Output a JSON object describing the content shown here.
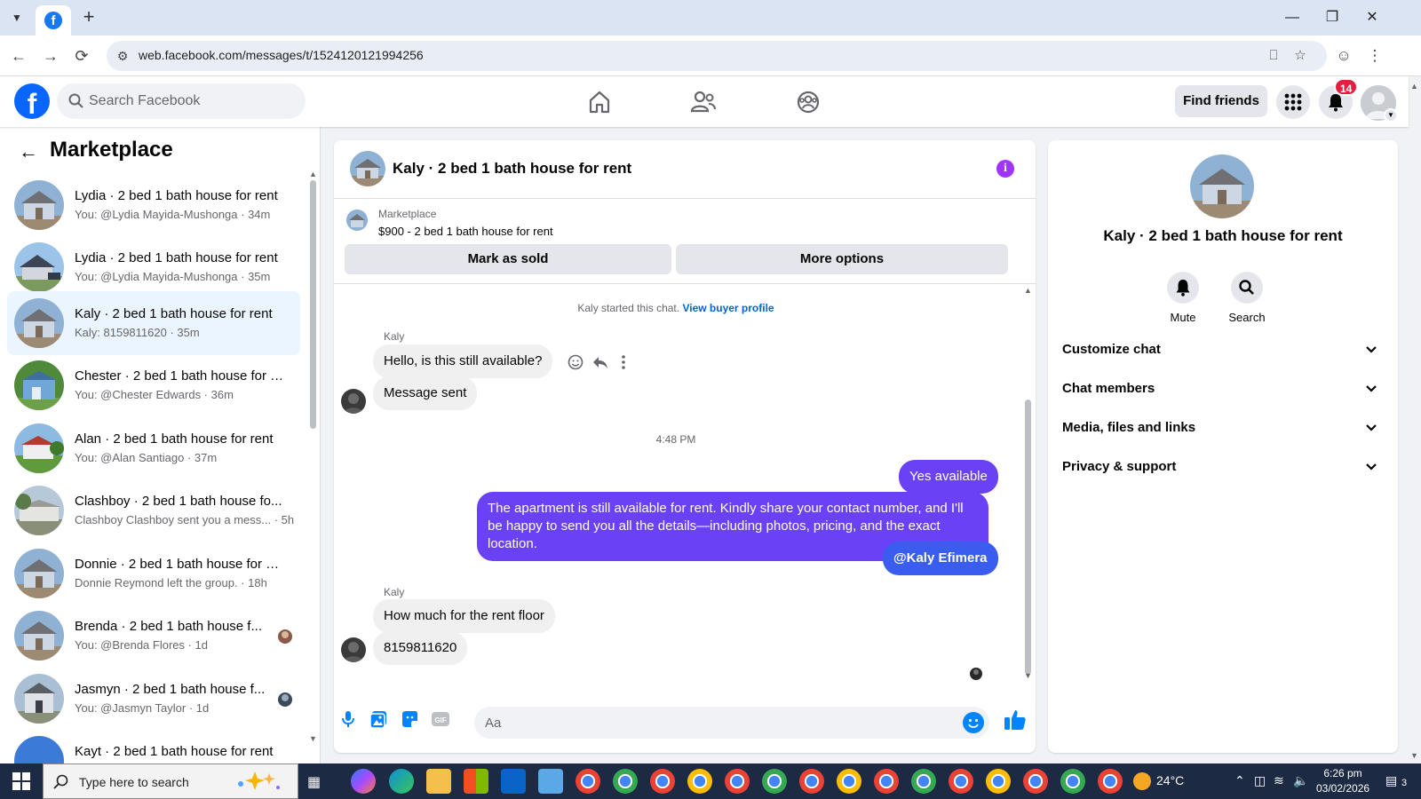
{
  "browser": {
    "url": "web.facebook.com/messages/t/1524120121994256",
    "tab_icon": "facebook-icon"
  },
  "header": {
    "search_placeholder": "Search Facebook",
    "find_friends": "Find friends",
    "notification_count": "14"
  },
  "sidebar": {
    "title": "Marketplace",
    "conversations": [
      {
        "title": "Lydia · 2 bed 1 bath house for rent",
        "sub": "You: @Lydia Mayida-Mushonga · 34m"
      },
      {
        "title": "Lydia · 2 bed 1 bath house for rent",
        "sub": "You: @Lydia Mayida-Mushonga · 35m"
      },
      {
        "title": "Kaly · 2 bed 1 bath house for rent",
        "sub": "Kaly: 8159811620 · 35m"
      },
      {
        "title": "Chester · 2 bed 1 bath house for …",
        "sub": "You: @Chester Edwards · 36m"
      },
      {
        "title": "Alan · 2 bed 1 bath house for rent",
        "sub": "You: @Alan Santiago · 37m"
      },
      {
        "title": "Clashboy · 2 bed 1 bath house fo...",
        "sub": "Clashboy Clashboy sent you a mess... · 5h"
      },
      {
        "title": "Donnie · 2 bed 1 bath house for …",
        "sub": "Donnie Reymond left the group. · 18h"
      },
      {
        "title": "Brenda · 2 bed 1 bath house f...",
        "sub": "You: @Brenda Flores · 1d"
      },
      {
        "title": "Jasmyn · 2 bed 1 bath house f...",
        "sub": "You: @Jasmyn Taylor · 1d"
      },
      {
        "title": "Kayt · 2 bed 1 bath house for rent",
        "sub": ""
      }
    ]
  },
  "chat": {
    "title": "Kaly · 2 bed 1 bath house for rent",
    "listing_source": "Marketplace",
    "listing_title": "$900 - 2 bed 1 bath house for rent",
    "mark_sold": "Mark as sold",
    "more_options": "More options",
    "system_text": "Kaly started this chat.",
    "system_link": "View buyer profile",
    "timestamp": "4:48 PM",
    "messages": {
      "sender1": "Kaly",
      "m1": "Hello, is this still available?",
      "m2": "Message sent",
      "m3": "Yes available",
      "m4": "The apartment is still available for rent. Kindly share your contact number, and I'll be happy to send you all the details—including photos, pricing, and the exact location.",
      "m5": "@Kaly Efimera",
      "sender2": "Kaly",
      "m6": "How much for the rent floor",
      "m7": "8159811620"
    },
    "composer_placeholder": "Aa"
  },
  "right_panel": {
    "title": "Kaly · 2 bed 1 bath house for rent",
    "mute": "Mute",
    "search": "Search",
    "sections": [
      "Customize chat",
      "Chat members",
      "Media, files and links",
      "Privacy & support"
    ]
  },
  "taskbar": {
    "search_placeholder": "Type here to search",
    "weather": "24°C",
    "time": "6:26 pm",
    "date": "03/02/2026",
    "notification_count": "3"
  },
  "colors": {
    "fb_blue": "#0866ff",
    "outgoing_bubble": "#6a41f4",
    "active_conv": "#ebf5ff"
  }
}
